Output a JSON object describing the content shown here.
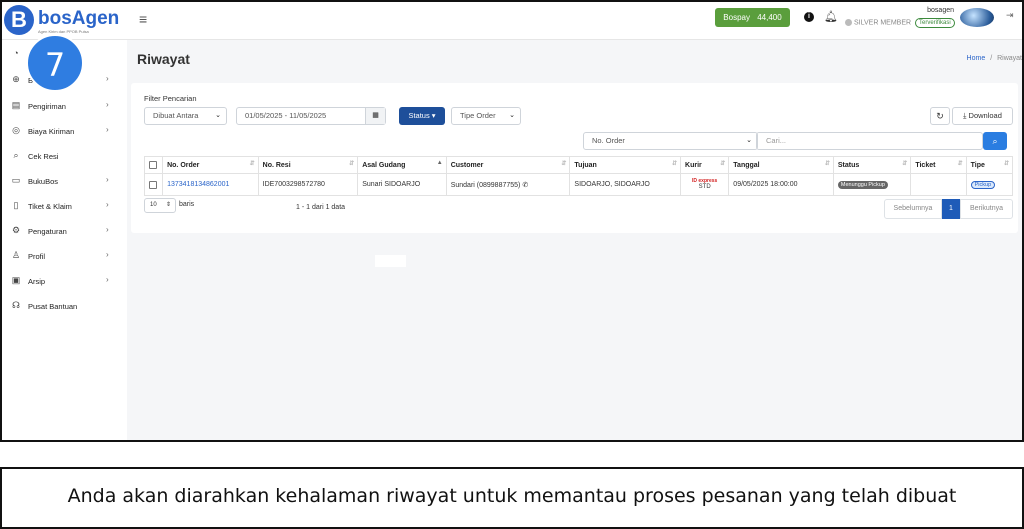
{
  "header": {
    "logo_letter": "B",
    "logo_text": "bosAgen",
    "logo_tagline": "Agen Kirim dan PPOB Pulsa",
    "menu_icon": "hamburger-icon",
    "bospay_label": "Bospay",
    "bospay_amount": "44,400",
    "user_name": "bosagen",
    "member_level": "SILVER MEMBER",
    "verified_label": "Terverifikasi"
  },
  "step_number": "7",
  "sidebar": {
    "items": [
      {
        "label": "",
        "icon": "dashboard-icon",
        "has_chevron": false
      },
      {
        "label": "B",
        "icon": "plus-circle-icon",
        "has_chevron": true
      },
      {
        "label": "Pengiriman",
        "icon": "list-icon",
        "has_chevron": true
      },
      {
        "label": "Biaya Kiriman",
        "icon": "location-icon",
        "has_chevron": true
      },
      {
        "label": "Cek Resi",
        "icon": "search-icon",
        "has_chevron": false
      },
      {
        "label": "BukuBos",
        "icon": "book-icon",
        "has_chevron": true
      },
      {
        "label": "Tiket & Klaim",
        "icon": "ticket-icon",
        "has_chevron": true
      },
      {
        "label": "Pengaturan",
        "icon": "gear-icon",
        "has_chevron": true
      },
      {
        "label": "Profil",
        "icon": "user-icon",
        "has_chevron": true
      },
      {
        "label": "Arsip",
        "icon": "archive-icon",
        "has_chevron": true
      },
      {
        "label": "Pusat Bantuan",
        "icon": "headset-icon",
        "has_chevron": false
      }
    ]
  },
  "page": {
    "title": "Riwayat",
    "breadcrumb_home": "Home",
    "breadcrumb_sep": "/",
    "breadcrumb_current": "Riwayat"
  },
  "filter": {
    "title": "Filter Pencarian",
    "date_mode": "Dibuat Antara",
    "date_range": "01/05/2025 - 11/05/2025",
    "status_label": "Status",
    "order_type": "Tipe Order",
    "refresh_icon": "refresh-icon",
    "download_label": "Download",
    "search_field": "No. Order",
    "search_placeholder": "Cari..."
  },
  "table": {
    "headers": [
      "No. Order",
      "No. Resi",
      "Asal Gudang",
      "Customer",
      "Tujuan",
      "Kurir",
      "Tanggal",
      "Status",
      "Ticket",
      "Tipe"
    ],
    "rows": [
      {
        "no_order": "1373418134862001",
        "no_resi": "IDE7003298572780",
        "asal_gudang": "Sunari SIDOARJO",
        "customer": "Sundari (0899887755)",
        "tujuan": "SIDOARJO, SIDOARJO",
        "kurir_logo": "ID express",
        "kurir_service": "STD",
        "tanggal": "09/05/2025 18:00:00",
        "status": "Menunggu Pickup",
        "ticket": "",
        "tipe": "Pickup"
      }
    ]
  },
  "pagination": {
    "per_page": "10",
    "per_page_label": "baris",
    "info": "1 - 1 dari 1 data",
    "prev": "Sebelumnya",
    "current": "1",
    "next": "Berikutnya"
  },
  "caption": "Anda akan diarahkan kehalaman riwayat untuk memantau proses pesanan yang telah dibuat"
}
